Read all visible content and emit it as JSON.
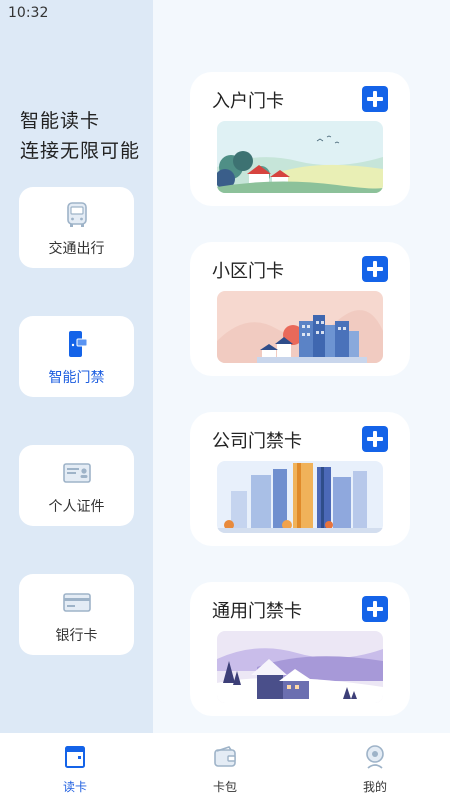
{
  "status": {
    "time": "10:32"
  },
  "sidebar": {
    "slogan_line1": "智能读卡",
    "slogan_line2": "连接无限可能",
    "items": [
      {
        "label": "交通出行",
        "icon": "bus-icon",
        "active": false
      },
      {
        "label": "智能门禁",
        "icon": "door-card-icon",
        "active": true
      },
      {
        "label": "个人证件",
        "icon": "id-card-icon",
        "active": false
      },
      {
        "label": "银行卡",
        "icon": "bank-card-icon",
        "active": false
      }
    ]
  },
  "cards": [
    {
      "title": "入户门卡",
      "illustration": "countryside-house-illustration"
    },
    {
      "title": "小区门卡",
      "illustration": "residential-buildings-illustration"
    },
    {
      "title": "公司门禁卡",
      "illustration": "office-towers-illustration"
    },
    {
      "title": "通用门禁卡",
      "illustration": "snowy-cabin-illustration"
    }
  ],
  "tabbar": {
    "items": [
      {
        "label": "读卡",
        "icon": "card-reader-icon",
        "active": true
      },
      {
        "label": "卡包",
        "icon": "wallet-icon",
        "active": false
      },
      {
        "label": "我的",
        "icon": "profile-icon",
        "active": false
      }
    ]
  },
  "colors": {
    "accent": "#1463e8",
    "active_text": "#1f5fe0",
    "sidebar_bg": "#dde9f6",
    "content_bg": "#f3f8fd"
  }
}
